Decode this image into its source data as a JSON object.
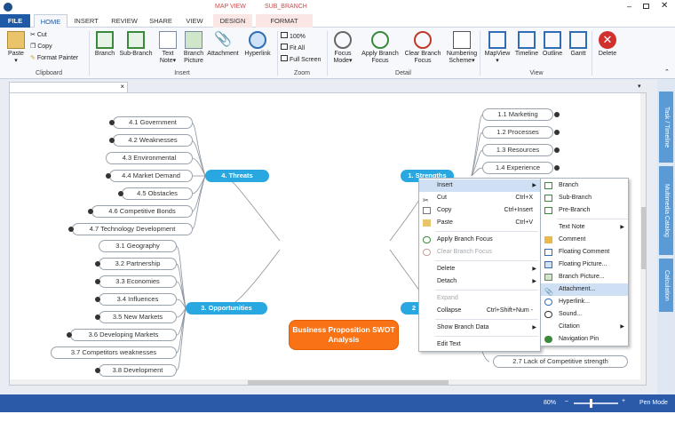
{
  "tabs": {
    "file": "FILE",
    "home": "HOME",
    "insert": "INSERT",
    "review": "REVIEW",
    "share": "SHARE",
    "view": "VIEW",
    "design": "DESIGN",
    "format": "FORMAT",
    "ctx_mapview": "MAP VIEW",
    "ctx_subbranch": "SUB_BRANCH"
  },
  "clipboard": {
    "paste": "Paste",
    "cut": "Cut",
    "copy": "Copy",
    "format_painter": "Format Painter",
    "label": "Clipboard"
  },
  "insert_group": {
    "branch": "Branch",
    "sub_branch": "Sub-Branch",
    "text_note": "Text",
    "text_note2": "Note",
    "branch_picture": "Branch",
    "branch_picture2": "Picture",
    "attachment": "Attachment",
    "hyperlink": "Hyperlink",
    "label": "Insert"
  },
  "zoom_group": {
    "z100": "100%",
    "fit_all": "Fit All",
    "full_screen": "Full Screen",
    "label": "Zoom"
  },
  "detail_group": {
    "focus_mode": "Focus",
    "focus_mode2": "Mode",
    "apply_focus": "Apply Branch",
    "apply_focus2": "Focus",
    "clear_focus": "Clear Branch",
    "clear_focus2": "Focus",
    "numbering": "Numbering",
    "numbering2": "Scheme",
    "label": "Detail"
  },
  "view_group": {
    "mapview": "MapView",
    "timeline": "Timeline",
    "outline": "Outline",
    "gantt": "Gantt",
    "label": "View"
  },
  "delete_label": "Delete",
  "sidebar": {
    "task": "Task / Timeline",
    "media": "Multimedia Catalog",
    "calc": "Calculation"
  },
  "status": {
    "zoom": "80%",
    "mode": "Pen Mode"
  },
  "map": {
    "central": "Business Proposition SWOT Analysis",
    "threats": "4.  Threats",
    "opportunities": "3.  Opportunities",
    "strengths": "1.  Strengths",
    "weaknesses_main": "2",
    "t1": "4.1  Government",
    "t2": "4.2  Weaknesses",
    "t3": "4.3  Environmental",
    "t4": "4.4  Market Demand",
    "t5": "4.5  Obstacles",
    "t6": "4.6  Competitive Bonds",
    "t7": "4.7  Technology Development",
    "o1": "3.1  Geography",
    "o2": "3.2  Partnership",
    "o3": "3.3  Economies",
    "o4": "3.4  Influences",
    "o5": "3.5  New Markets",
    "o6": "3.6  Developing Markets",
    "o7": "3.7  Competitors weaknesses",
    "o8": "3.8  Development",
    "s1": "1.1  Marketing",
    "s2": "1.2  Processes",
    "s3": "1.3  Resources",
    "s4": "1.4  Experience",
    "w7": "2.7  Lack of Competitive strength"
  },
  "context_menu": {
    "insert": "Insert",
    "cut": "Cut",
    "cut_sc": "Ctrl+X",
    "copy": "Copy",
    "copy_sc": "Ctrl+Insert",
    "paste": "Paste",
    "paste_sc": "Ctrl+V",
    "apply_focus": "Apply Branch Focus",
    "clear_focus": "Clear Branch Focus",
    "delete": "Delete",
    "detach": "Detach",
    "expand": "Expand",
    "collapse": "Collapse",
    "collapse_sc": "Ctrl+Shift+Num -",
    "show_data": "Show Branch Data",
    "edit_text": "Edit Text"
  },
  "submenu": {
    "branch": "Branch",
    "sub_branch": "Sub-Branch",
    "pre_branch": "Pre-Branch",
    "text_note": "Text Note",
    "comment": "Comment",
    "floating_comment": "Floating Comment",
    "floating_picture": "Floating Picture...",
    "branch_picture": "Branch Picture...",
    "attachment": "Attachment...",
    "hyperlink": "Hyperlink...",
    "sound": "Sound...",
    "citation": "Citation",
    "navigation_pin": "Navigation Pin"
  }
}
